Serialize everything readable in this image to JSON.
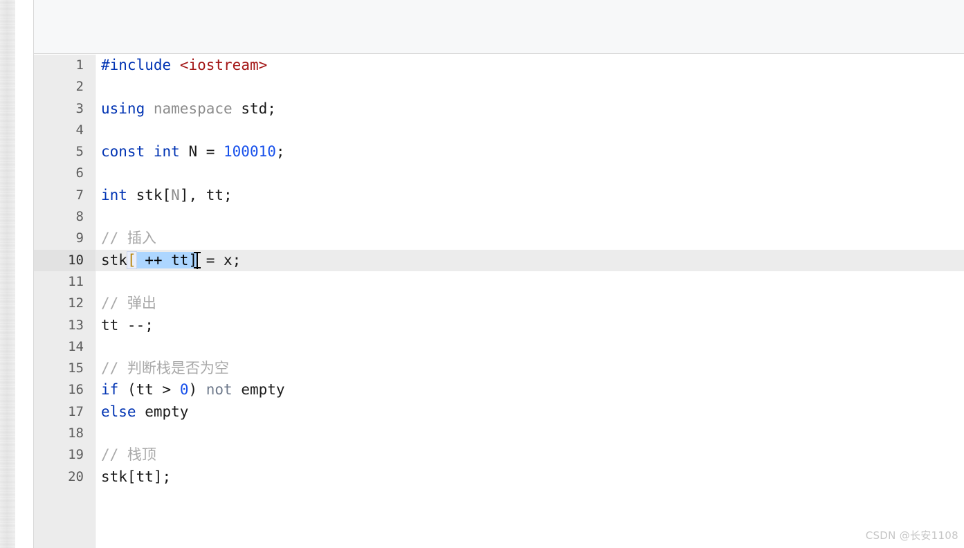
{
  "window": {
    "header_title": "",
    "watermark": "CSDN @长安1108"
  },
  "editor": {
    "language": "C++",
    "active_line": 10,
    "selection_text": " ++ tt]",
    "colors": {
      "keyword": "#0033b3",
      "number": "#1750eb",
      "string": "#a31515",
      "comment": "#a9a9a9",
      "plain": "#1a1a1a",
      "selection": "#add6ff",
      "active_line": "#ececec",
      "gutter": "#ececec",
      "header": "#f7f8f9",
      "background": "#ffffff"
    },
    "lines": [
      {
        "n": "1",
        "text": "#include <iostream>"
      },
      {
        "n": "2",
        "text": ""
      },
      {
        "n": "3",
        "text": "using namespace std;"
      },
      {
        "n": "4",
        "text": ""
      },
      {
        "n": "5",
        "text": "const int N = 100010;"
      },
      {
        "n": "6",
        "text": ""
      },
      {
        "n": "7",
        "text": "int stk[N], tt;"
      },
      {
        "n": "8",
        "text": ""
      },
      {
        "n": "9",
        "text": "// 插入"
      },
      {
        "n": "10",
        "text": "stk[ ++ tt] = x;"
      },
      {
        "n": "11",
        "text": ""
      },
      {
        "n": "12",
        "text": "// 弹出"
      },
      {
        "n": "13",
        "text": "tt --;"
      },
      {
        "n": "14",
        "text": ""
      },
      {
        "n": "15",
        "text": "// 判断栈是否为空"
      },
      {
        "n": "16",
        "text": "if (tt > 0) not empty"
      },
      {
        "n": "17",
        "text": "else empty"
      },
      {
        "n": "18",
        "text": ""
      },
      {
        "n": "19",
        "text": "// 栈顶"
      },
      {
        "n": "20",
        "text": "stk[tt];"
      }
    ],
    "tokens": {
      "l1_a": "#include",
      "l1_b": " ",
      "l1_c": "<iostream>",
      "l3_a": "using",
      "l3_b": " ",
      "l3_c": "namespace",
      "l3_d": " ",
      "l3_e": "std;",
      "l5_a": "const int",
      "l5_b": " N = ",
      "l5_c": "100010",
      "l5_d": ";",
      "l7_a": "int",
      "l7_b": " stk[",
      "l7_c": "N",
      "l7_d": "], tt;",
      "l9_a": "// 插入",
      "l10_a": "stk",
      "l10_b": "[",
      "l10_c": " ++ tt]",
      "l10_d": " = x;",
      "l12_a": "// 弹出",
      "l13_a": "tt --;",
      "l15_a": "// 判断栈是否为空",
      "l16_a": "if",
      "l16_b": " (tt > ",
      "l16_c": "0",
      "l16_d": ") ",
      "l16_e": "not",
      "l16_f": " empty",
      "l17_a": "else",
      "l17_b": " empty",
      "l19_a": "// 栈顶",
      "l20_a": "stk[tt];"
    },
    "line_numbers": {
      "n1": "1",
      "n2": "2",
      "n3": "3",
      "n4": "4",
      "n5": "5",
      "n6": "6",
      "n7": "7",
      "n8": "8",
      "n9": "9",
      "n10": "10",
      "n11": "11",
      "n12": "12",
      "n13": "13",
      "n14": "14",
      "n15": "15",
      "n16": "16",
      "n17": "17",
      "n18": "18",
      "n19": "19",
      "n20": "20"
    }
  }
}
